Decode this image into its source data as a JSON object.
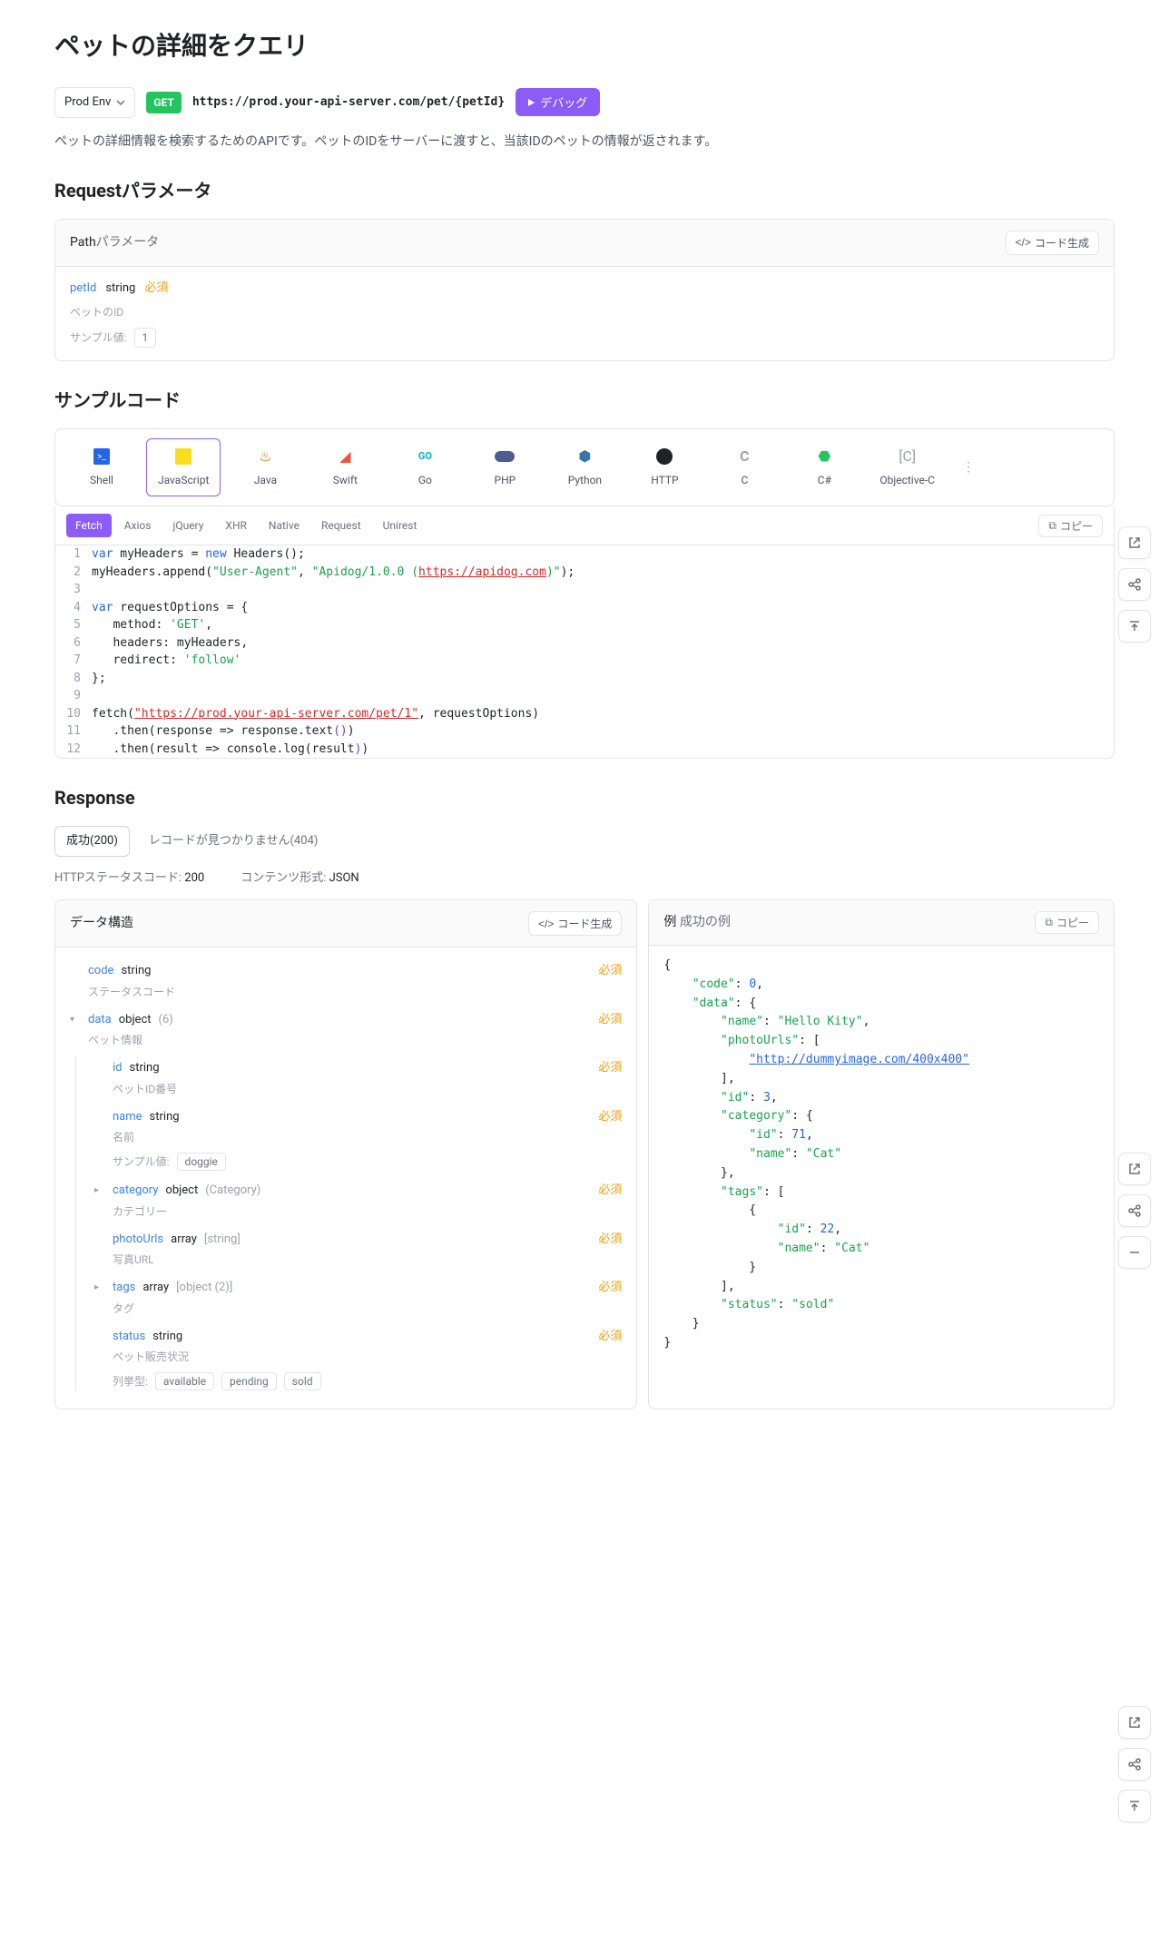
{
  "title": "ペットの詳細をクエリ",
  "env": {
    "label": "Prod Env"
  },
  "method": "GET",
  "url": "https://prod.your-api-server.com/pet/{petId}",
  "debug_label": "デバッグ",
  "description": "ペットの詳細情報を検索するためのAPIです。ペットのIDをサーバーに渡すと、当該IDのペットの情報が返されます。",
  "request": {
    "heading": "Requestパラメータ",
    "panel_title_prefix": "Path",
    "panel_title_suffix": "パラメータ",
    "codegen_label": "コード生成",
    "param": {
      "name": "petId",
      "type": "string",
      "required": "必須",
      "desc": "ペットのID",
      "sample_label": "サンプル値:",
      "sample_value": "1"
    }
  },
  "sample": {
    "heading": "サンプルコード",
    "langs": [
      {
        "label": "Shell"
      },
      {
        "label": "JavaScript"
      },
      {
        "label": "Java"
      },
      {
        "label": "Swift"
      },
      {
        "label": "Go"
      },
      {
        "label": "PHP"
      },
      {
        "label": "Python"
      },
      {
        "label": "HTTP"
      },
      {
        "label": "C"
      },
      {
        "label": "C#"
      },
      {
        "label": "Objective-C"
      }
    ],
    "sublangs": [
      "Fetch",
      "Axios",
      "jQuery",
      "XHR",
      "Native",
      "Request",
      "Unirest"
    ],
    "copy_label": "コピー",
    "code": {
      "l1_var": "var",
      "l1_rest": " myHeaders = ",
      "l1_new": "new",
      "l1_cls": " Headers",
      "l1_end": "();",
      "l2_a": "myHeaders.append(",
      "l2_s1": "\"User-Agent\"",
      "l2_c": ", ",
      "l2_s2": "\"Apidog/1.0.0 (",
      "l2_url": "https://apidog.com",
      "l2_s3": ")\"",
      "l2_end": ");",
      "l4_var": "var",
      "l4_rest": " requestOptions = {",
      "l5_k": "   method: ",
      "l5_v": "'GET'",
      "l5_c": ",",
      "l6": "   headers: myHeaders,",
      "l7_k": "   redirect: ",
      "l7_v": "'follow'",
      "l8": "};",
      "l10_a": "fetch(",
      "l10_url": "\"https://prod.your-api-server.com/pet/1\"",
      "l10_b": ", requestOptions)",
      "l11_a": "   .then(response => response.text",
      "l11_p": "()",
      "l11_b": ")",
      "l12_a": "   .then(result => console.log(result",
      "l12_p": ")",
      "l12_b": ")"
    }
  },
  "response": {
    "heading": "Response",
    "tabs": [
      {
        "label": "成功(200)"
      },
      {
        "label": "レコードが見つかりません(404)"
      }
    ],
    "status_label": "HTTPステータスコード: ",
    "status_value": "200",
    "content_label": "コンテンツ形式: ",
    "content_value": "JSON",
    "schema_heading": "データ構造",
    "codegen_label": "コード生成",
    "example_heading_prefix": "例",
    "example_heading_suffix": "成功の例",
    "copy_label": "コピー",
    "required_label": "必須",
    "fields": {
      "code": {
        "name": "code",
        "type": "string",
        "desc": "ステータスコード"
      },
      "data": {
        "name": "data",
        "type": "object",
        "count": "(6)",
        "desc": "ペット情報"
      },
      "id": {
        "name": "id",
        "type": "string",
        "desc": "ペットID番号"
      },
      "name_f": {
        "name": "name",
        "type": "string",
        "desc": "名前",
        "sample_label": "サンプル値:",
        "sample": "doggie"
      },
      "category": {
        "name": "category",
        "type": "object",
        "subtype": "(Category)",
        "desc": "カテゴリー"
      },
      "photoUrls": {
        "name": "photoUrls",
        "type": "array",
        "subtype": "[string]",
        "desc": "写真URL"
      },
      "tags": {
        "name": "tags",
        "type": "array",
        "subtype": "[object (2)]",
        "desc": "タグ"
      },
      "status": {
        "name": "status",
        "type": "string",
        "desc": "ペット販売状況",
        "enum_label": "列挙型:",
        "enums": [
          "available",
          "pending",
          "sold"
        ]
      }
    },
    "example_json": {
      "code": 0,
      "data": {
        "name": "Hello Kity",
        "photoUrls": [
          "http://dummyimage.com/400x400"
        ],
        "id": 3,
        "category": {
          "id": 71,
          "name": "Cat"
        },
        "tags": [
          {
            "id": 22,
            "name": "Cat"
          }
        ],
        "status": "sold"
      }
    }
  }
}
